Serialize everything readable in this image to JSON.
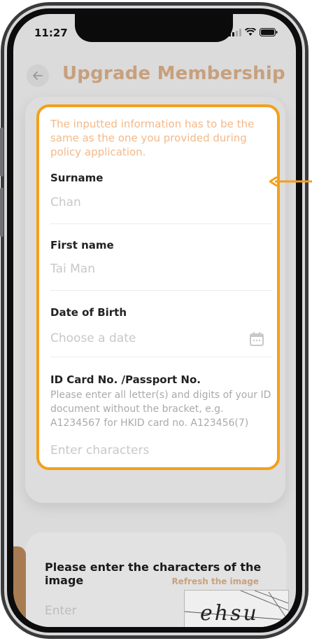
{
  "status_bar": {
    "time": "11:27"
  },
  "header": {
    "back_icon": "back-arrow-icon",
    "title": "Upgrade Membership"
  },
  "form": {
    "notice": "The inputted information has to be the same as the one you provided during policy application.",
    "surname": {
      "label": "Surname",
      "placeholder": "Chan"
    },
    "first_name": {
      "label": "First name",
      "placeholder": "Tai Man"
    },
    "dob": {
      "label": "Date of Birth",
      "placeholder": "Choose a date",
      "icon": "calendar-icon"
    },
    "id_card": {
      "label": "ID Card No. /Passport No.",
      "hint": "Please enter all letter(s) and digits of your ID document without the bracket, e.g. A1234567 for HKID card no. A123456(7)",
      "placeholder": "Enter characters"
    }
  },
  "captcha": {
    "title": "Please enter the characters of the image",
    "refresh_label": "Refresh the image",
    "input_placeholder": "Enter",
    "image_text": "ehsu"
  },
  "colors": {
    "accent": "#c6a07e",
    "highlight": "#f4a01a",
    "notice": "#f2b98a"
  }
}
